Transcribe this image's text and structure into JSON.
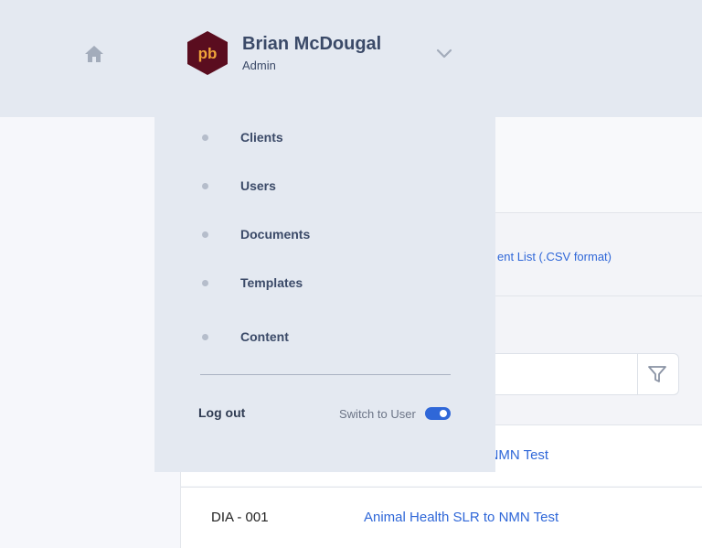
{
  "header": {
    "user_name": "Brian McDougal",
    "user_role": "Admin",
    "avatar_text": "pb",
    "home_icon": "home-icon",
    "dropdown_icon": "chevron-down-icon"
  },
  "dropdown": {
    "items": [
      {
        "label": "Clients"
      },
      {
        "label": "Users"
      },
      {
        "label": "Documents"
      },
      {
        "label": "Templates"
      },
      {
        "label": "Content"
      }
    ],
    "logout_label": "Log out",
    "switch_label": "Switch to User",
    "switch_on": true
  },
  "main": {
    "download_link_visible": "ent List (.CSV format)",
    "filter_icon": "filter-icon",
    "rows": [
      {
        "code": "",
        "name_visible": "o NMN Test"
      },
      {
        "code": "DIA - 001",
        "name_visible": "Animal Health SLR to NMN Test"
      }
    ]
  },
  "colors": {
    "accent": "#2f67d8",
    "avatar_bg": "#5a0d1f",
    "avatar_text": "#f0a43a",
    "topbar_bg": "#e4e9f1"
  }
}
